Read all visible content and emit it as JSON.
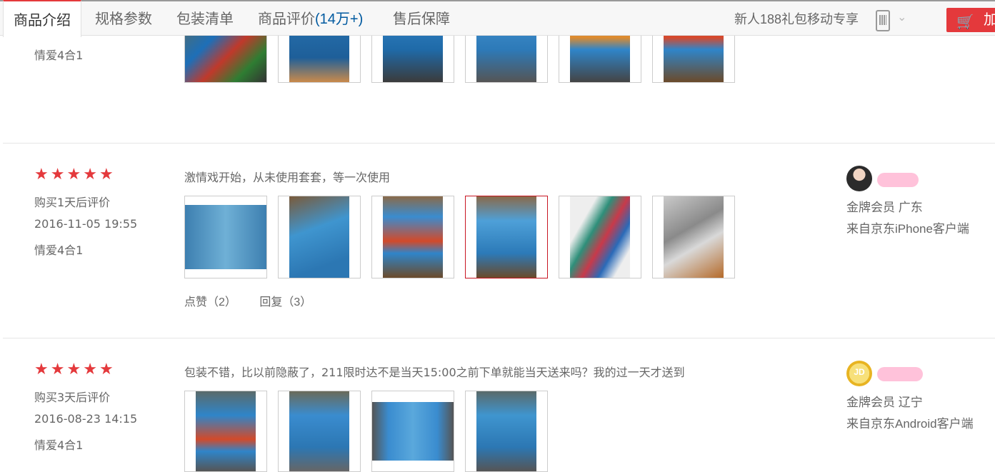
{
  "tabs": [
    {
      "label": "商品介绍"
    },
    {
      "label": "规格参数"
    },
    {
      "label": "包装清单"
    },
    {
      "label": "商品评价",
      "count": "(14万+)"
    },
    {
      "label": "售后保障"
    }
  ],
  "promo": "新人188礼包移动专享",
  "add_cart_label": "加",
  "reviews": [
    {
      "variant": "情爱4合1"
    },
    {
      "stars": 5,
      "after": "购买1天后评价",
      "date": "2016-11-05 19:55",
      "variant": "情爱4合1",
      "content": "激情戏开始，从未使用套套，等一次使用",
      "likes": "点赞（2）",
      "replies": "回复（3）",
      "member": "金牌会员  广东",
      "client": "来自京东iPhone客户端"
    },
    {
      "stars": 5,
      "after": "购买3天后评价",
      "date": "2016-08-23 14:15",
      "variant": "情爱4合1",
      "content": "包装不错，比以前隐蔽了，211限时达不是当天15:00之前下单就能当天送来吗？我的过一天才送到",
      "member": "金牌会员  辽宁",
      "client": "来自京东Android客户端",
      "avatar_text": "JD"
    }
  ],
  "colors": {
    "accent": "#e4393c",
    "link": "#005aa0"
  }
}
